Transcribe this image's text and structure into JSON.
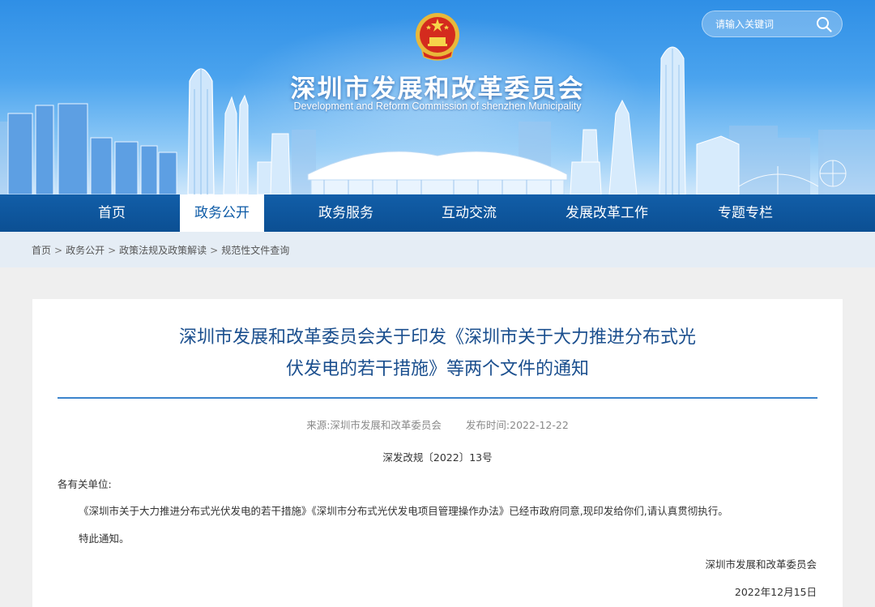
{
  "header": {
    "site_title": "深圳市发展和改革委员会",
    "site_subtitle": "Development and Reform Commission of shenzhen Municipality",
    "search_placeholder": "请输入关键词"
  },
  "nav": {
    "items": [
      {
        "label": "首页"
      },
      {
        "label": "政务公开"
      },
      {
        "label": "政务服务"
      },
      {
        "label": "互动交流"
      },
      {
        "label": "发展改革工作"
      },
      {
        "label": "专题专栏"
      }
    ],
    "active_label": "政务公开"
  },
  "breadcrumb": {
    "items": [
      "首页",
      "政务公开",
      "政策法规及政策解读",
      "规范性文件查询"
    ],
    "separator": ">"
  },
  "article": {
    "title_line1": "深圳市发展和改革委员会关于印发《深圳市关于大力推进分布式光",
    "title_line2": "伏发电的若干措施》等两个文件的通知",
    "source_label": "来源:",
    "source": "深圳市发展和改革委员会",
    "date_label": "发布时间:",
    "date": "2022-12-22",
    "doc_number": "深发改规〔2022〕13号",
    "salutation": "各有关单位:",
    "paragraph1": "《深圳市关于大力推进分布式光伏发电的若干措施》《深圳市分布式光伏发电项目管理操作办法》已经市政府同意,现印发给你们,请认真贯彻执行。",
    "paragraph2": "特此通知。",
    "signature": "深圳市发展和改革委员会",
    "signature_date": "2022年12月15日"
  },
  "colors": {
    "nav_background": "#0b4f93",
    "title_color": "#1b4f8e",
    "rule_color": "#3b84cc",
    "breadcrumb_background": "#e5edf5"
  },
  "icons": {
    "search": "search-icon",
    "emblem": "national-emblem-icon"
  }
}
